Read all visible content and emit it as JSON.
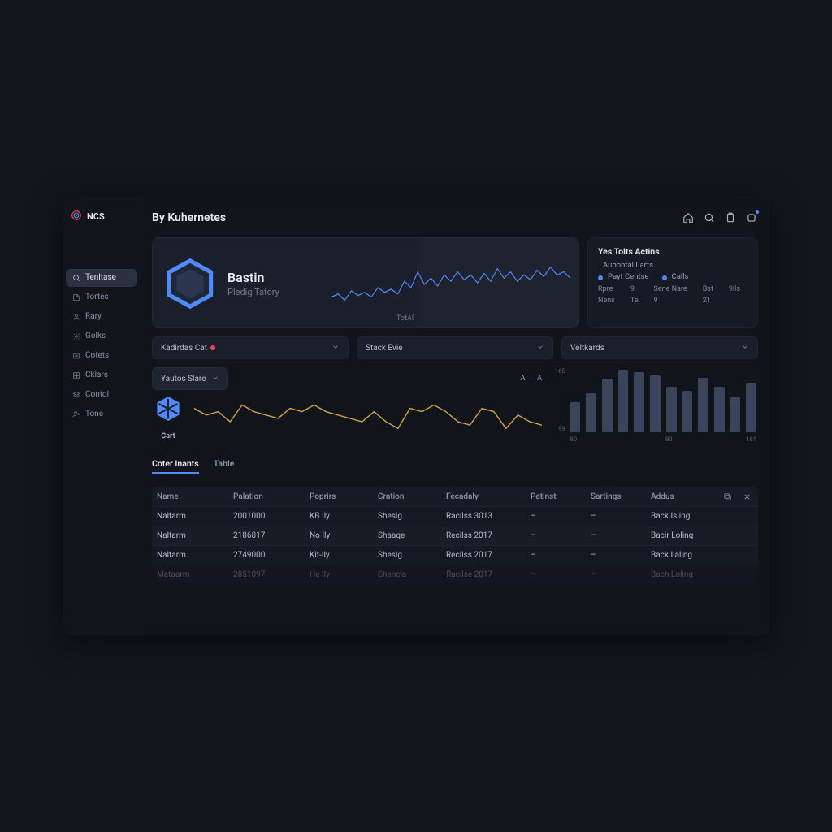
{
  "brand": {
    "name": "NCS"
  },
  "page_title": "By Kuhernetes",
  "sidebar": {
    "items": [
      {
        "label": "Tenltase",
        "icon": "search"
      },
      {
        "label": "Tortes",
        "icon": "file"
      },
      {
        "label": "Rary",
        "icon": "user"
      },
      {
        "label": "Golks",
        "icon": "gear"
      },
      {
        "label": "Cotets",
        "icon": "list"
      },
      {
        "label": "Cklars",
        "icon": "grid"
      },
      {
        "label": "Contol",
        "icon": "layers"
      },
      {
        "label": "Tone",
        "icon": "user-plus"
      }
    ]
  },
  "hero": {
    "title": "Bastin",
    "subtitle": "Pledig Tatory",
    "tick": "TotAl"
  },
  "actions_panel": {
    "title": "Yes Tolts Actins",
    "row1": "Aubontal Larts",
    "row2a": "Payt Centse",
    "row2b": "Calls",
    "grid": [
      "Rpre",
      "9",
      "Sene Nare",
      "Bst",
      "9ils",
      "Nens",
      "Te",
      "9",
      "21",
      ""
    ]
  },
  "filters": [
    {
      "label": "Kadirdas Cat",
      "dot": true
    },
    {
      "label": "Stack Evie"
    },
    {
      "label": "Veltkards"
    }
  ],
  "sub_filter": {
    "label": "Yautos Slare"
  },
  "crumbs": {
    "a": "A",
    "b": "A"
  },
  "small_hex_caption": "Cart",
  "tabs": [
    {
      "label": "Coter Inants",
      "active": true
    },
    {
      "label": "Table",
      "active": false
    }
  ],
  "table": {
    "headers": [
      "Name",
      "Palation",
      "Poprirs",
      "Cration",
      "Fecadaly",
      "Patinst",
      "Sartings",
      "Addus"
    ],
    "rows": [
      [
        "Naltarm",
        "2001000",
        "KB Ily",
        "Sheslg",
        "Racilss 3013",
        "–",
        "–",
        "Back Isling"
      ],
      [
        "Naltarm",
        "2186817",
        "No Ily",
        "Shaage",
        "Recilss 2017",
        "–",
        "–",
        "Bacir Loling"
      ],
      [
        "Naltarm",
        "2749000",
        "Kit-Ily",
        "Sheslg",
        "Recilss 2017",
        "–",
        "–",
        "Back Ilaling"
      ],
      [
        "Mataarm",
        "2851097",
        "He Ily",
        "Shencla",
        "Racilse 2017",
        "–",
        "–",
        "Bach Loling"
      ]
    ]
  },
  "chart_data": [
    {
      "type": "line",
      "title": "Bastin hero sparkline",
      "series": [
        {
          "name": "blue",
          "values": [
            30,
            32,
            28,
            34,
            31,
            33,
            30,
            36,
            33,
            35,
            32,
            40,
            36,
            46,
            38,
            42,
            37,
            44,
            40,
            46,
            41,
            44,
            39,
            45,
            40,
            48,
            42,
            46,
            40,
            44,
            41,
            47,
            43,
            49,
            44,
            46,
            42
          ]
        }
      ],
      "ylim": [
        20,
        55
      ],
      "color": "#4f8bff"
    },
    {
      "type": "line",
      "title": "Cart line",
      "series": [
        {
          "name": "amber",
          "values": [
            52,
            48,
            50,
            44,
            54,
            50,
            48,
            46,
            52,
            50,
            54,
            50,
            48,
            46,
            44,
            50,
            44,
            40,
            52,
            50,
            54,
            50,
            44,
            42,
            52,
            50,
            40,
            48,
            44,
            42
          ]
        }
      ],
      "ylim": [
        30,
        60
      ],
      "color": "#d0a24a"
    },
    {
      "type": "bar",
      "categories": [
        "80",
        "",
        "",
        "",
        "",
        "",
        "90",
        "",
        "",
        "",
        "",
        "161"
      ],
      "values": [
        46,
        60,
        82,
        96,
        92,
        88,
        70,
        64,
        84,
        70,
        54,
        76
      ],
      "ylim": [
        0,
        100
      ],
      "ylabel_top": "165",
      "ylabel_bot": "99",
      "color": "#3a445a"
    }
  ]
}
